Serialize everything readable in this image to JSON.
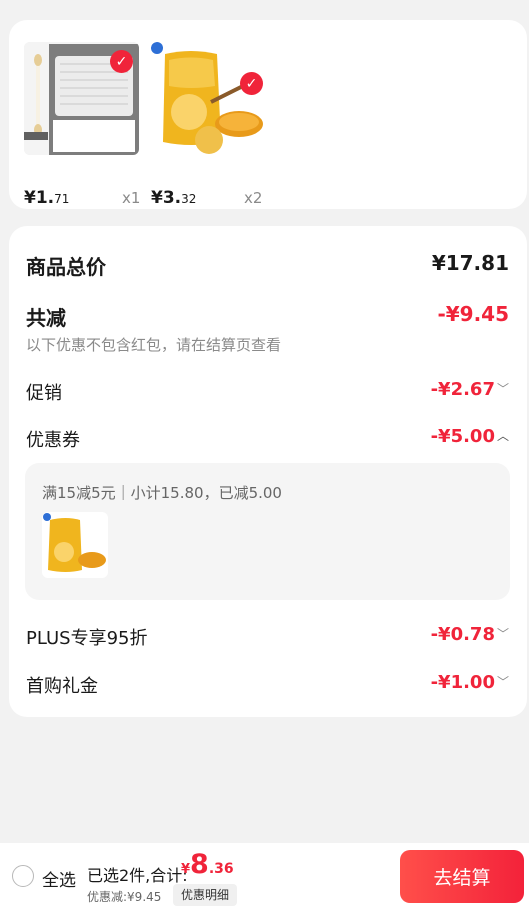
{
  "products": [
    {
      "name": "cotton-swabs",
      "image_text": "竹棉棒签·袋装 100支/包",
      "price_int": "¥1.",
      "price_dec": "71",
      "qty": "x1",
      "selected": true
    },
    {
      "name": "honey-chips",
      "image_text": "噶扎扎",
      "price_int": "¥3.",
      "price_dec": "32",
      "qty": "x2",
      "selected": true
    }
  ],
  "summary": {
    "total_label": "商品总价",
    "total_value": "¥17.81",
    "reduce_label": "共减",
    "reduce_value": "-¥9.45",
    "note": "以下优惠不包含红包，请在结算页查看",
    "promo_label": "促销",
    "promo_value": "-¥2.67",
    "coupon_label": "优惠券",
    "coupon_value": "-¥5.00",
    "coupon_detail": "满15减5元｜小计15.80，已减5.00",
    "plus_label": "PLUS专享95折",
    "plus_value": "-¥0.78",
    "first_label": "首购礼金",
    "first_value": "-¥1.00"
  },
  "footer": {
    "select_all": "全选",
    "selected_text": "已选2件,合计:",
    "currency": "¥",
    "total_int": "8",
    "total_dec": ".36",
    "discount_text": "优惠减:¥9.45",
    "detail_btn": "优惠明细",
    "checkout": "去结算"
  },
  "colors": {
    "accent": "#f0243a",
    "background": "#f2f2f2"
  }
}
